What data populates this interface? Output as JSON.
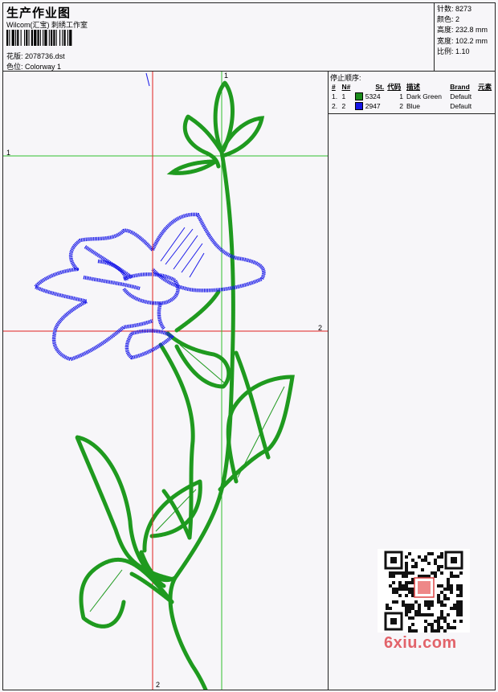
{
  "header": {
    "title": "生产作业图",
    "company": "Wilcom(汇宝) 刺绣工作室",
    "design_label": "花版:",
    "design_file": "2078736.dst",
    "colorway_label": "色位:",
    "colorway": "Colorway 1"
  },
  "stats": [
    {
      "label": "针数:",
      "value": "8273"
    },
    {
      "label": "颜色:",
      "value": "2"
    },
    {
      "label": "高度:",
      "value": "232.8 mm"
    },
    {
      "label": "宽度:",
      "value": "102.2 mm"
    },
    {
      "label": "比例:",
      "value": "1.10"
    }
  ],
  "stop_sequence": {
    "title": "停止顺序:",
    "headers": [
      "#",
      "N#",
      "St.",
      "代码",
      "描述",
      "Brand",
      "元素"
    ],
    "rows": [
      {
        "num": "1.",
        "n": "1",
        "color": "#1a8c1a",
        "stitches": "5324",
        "code": "1",
        "desc": "Dark Green",
        "brand": "Default"
      },
      {
        "num": "2.",
        "n": "2",
        "color": "#1414e6",
        "stitches": "2947",
        "code": "2",
        "desc": "Blue",
        "brand": "Default"
      }
    ]
  },
  "guides": {
    "h1": "1",
    "h2": "2",
    "v1": "1",
    "v2": "2"
  },
  "watermark": "6xiu.com",
  "colors": {
    "green": "#1f9a1f",
    "blue": "#1a1ae8",
    "guide_red": "#e02020",
    "guide_green": "#30c030"
  }
}
